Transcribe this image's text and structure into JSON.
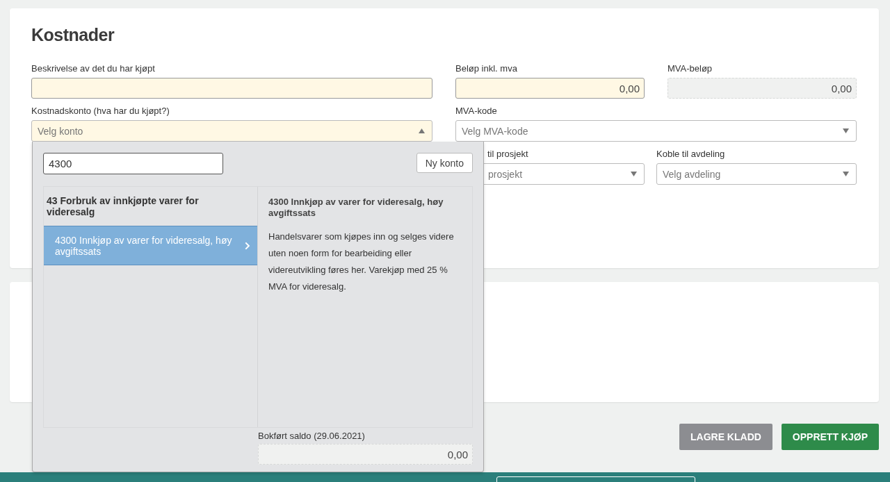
{
  "title": "Kostnader",
  "description": {
    "label": "Beskrivelse av det du har kjøpt",
    "required": true
  },
  "amount": {
    "label": "Beløp inkl. mva",
    "value": "0,00",
    "required": true
  },
  "vat_amount": {
    "label": "MVA-beløp",
    "value": "0,00",
    "readonly": true
  },
  "account": {
    "label": "Kostnadskonto (hva har du kjøpt?)",
    "placeholder": "Velg konto",
    "required": true,
    "open": true
  },
  "vat_code": {
    "label": "MVA-kode",
    "placeholder": "Velg MVA-kode"
  },
  "project": {
    "label": "til prosjekt",
    "placeholder": "prosjekt",
    "obscured": true
  },
  "department": {
    "label": "Koble til avdeling",
    "placeholder": "Velg avdeling"
  },
  "dropdown": {
    "search": "4300",
    "new_button": "Ny konto",
    "group": "43 Forbruk av innkjøpte varer for videresalg",
    "items": [
      {
        "label": "4300 Innkjøp av varer for videresalg, høy avgiftssats",
        "selected": true
      }
    ],
    "detail_title": "4300 Innkjøp av varer for videresalg, høy avgiftssats",
    "detail_text": "Handelsvarer som kjøpes inn og selges videre uten noen form for bearbeiding eller videreutvikling føres her. Varekjøp med 25 % MVA for videresalg.",
    "balance_label": "Bokført saldo (29.06.2021)",
    "balance": "0,00"
  },
  "buttons": [
    {
      "label": "LAGRE KLADD",
      "kind": "secondary"
    },
    {
      "label": "OPPRETT KJØP",
      "kind": "primary"
    }
  ]
}
